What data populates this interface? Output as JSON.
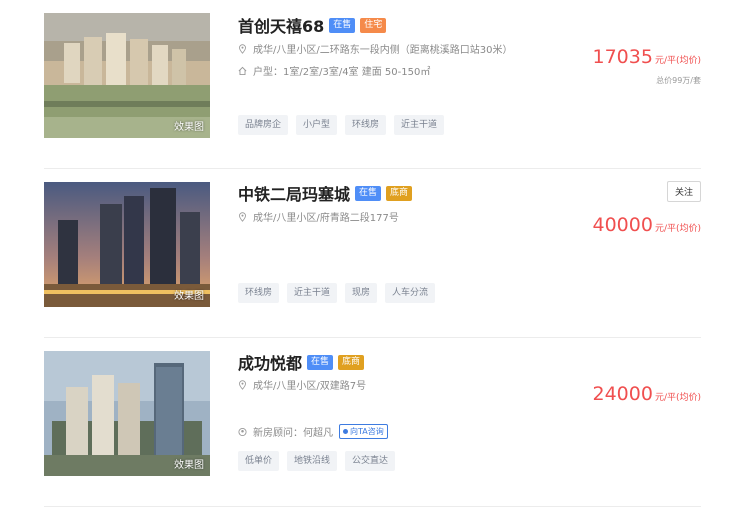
{
  "listings": [
    {
      "name": "首创天禧68",
      "tags": [
        {
          "text": "在售",
          "color": "#4f8ef7"
        },
        {
          "text": "住宅",
          "color": "#f58a4a"
        }
      ],
      "image_caption": "效果图",
      "address": "成华/八里小区/二环路东一段内侧（距离桃溪路口站30米）",
      "layout": "户型：1室/2室/3室/4室    建面 50-150㎡",
      "features": [
        "品牌房企",
        "小户型",
        "环线房",
        "近主干道"
      ],
      "price": "17035",
      "price_unit": "元/平(均价)",
      "total_price": "总价99万/套"
    },
    {
      "name": "中铁二局玛塞城",
      "tags": [
        {
          "text": "在售",
          "color": "#4f8ef7"
        },
        {
          "text": "底商",
          "color": "#e0a020"
        }
      ],
      "image_caption": "效果图",
      "address": "成华/八里小区/府青路二段177号",
      "features": [
        "环线房",
        "近主干道",
        "现房",
        "人车分流"
      ],
      "price": "40000",
      "price_unit": "元/平(均价)",
      "follow_label": "关注"
    },
    {
      "name": "成功悦都",
      "tags": [
        {
          "text": "在售",
          "color": "#4f8ef7"
        },
        {
          "text": "底商",
          "color": "#e0a020"
        }
      ],
      "image_caption": "效果图",
      "address": "成华/八里小区/双建路7号",
      "consultant": "新房顾问：何超凡",
      "ask_label": "向TA咨询",
      "features": [
        "低单价",
        "地铁沿线",
        "公交直达"
      ],
      "price": "24000",
      "price_unit": "元/平(均价)"
    }
  ]
}
